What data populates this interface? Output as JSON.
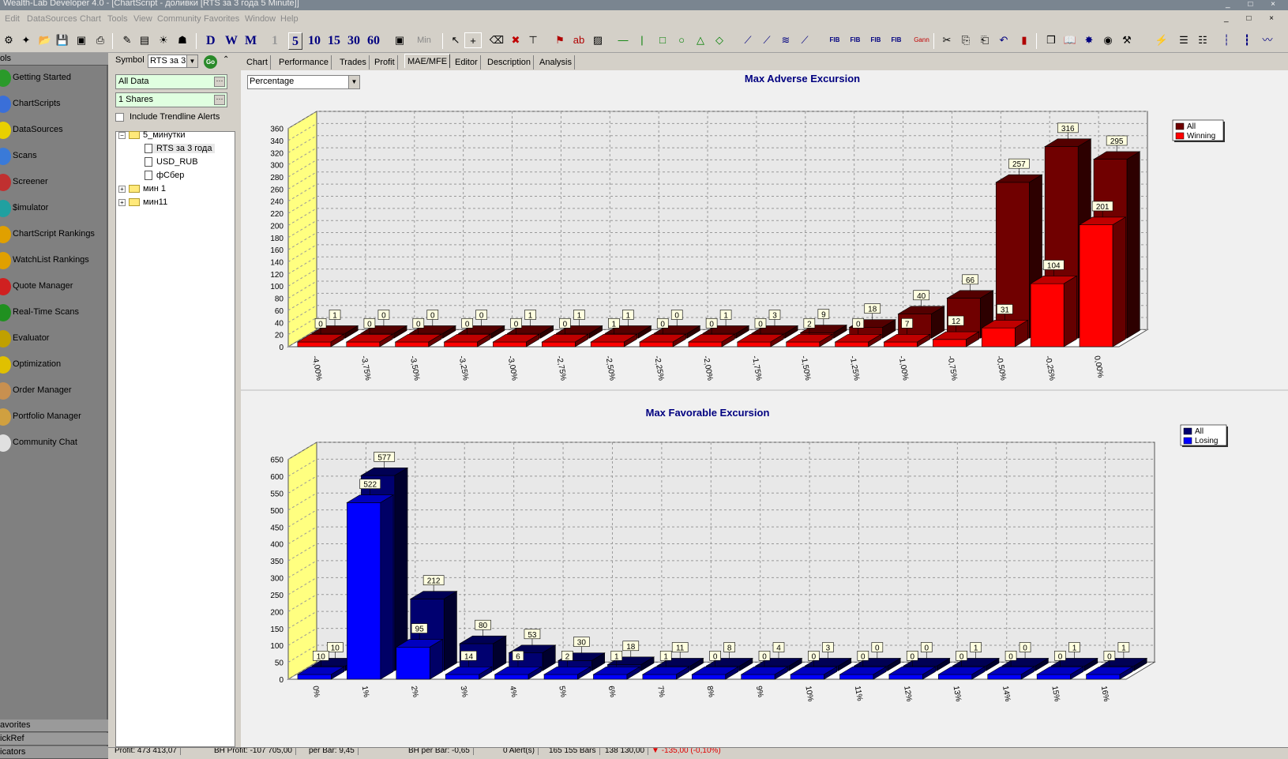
{
  "window": {
    "title": "Wealth-Lab Developer 4.0 - [ChartScript - доливки [RTS за 3 года 5 Minute]]"
  },
  "menu": [
    "Edit",
    "DataSources",
    "Chart",
    "Tools",
    "View",
    "Community",
    "Favorites",
    "Window",
    "Help"
  ],
  "toolbar": {
    "period_buttons": [
      "D",
      "W",
      "M",
      "1",
      "5",
      "10",
      "15",
      "30",
      "60"
    ],
    "min_label": "Min"
  },
  "left_panel": {
    "header": "ols",
    "items": [
      {
        "label": "Getting Started",
        "icon": "getting-started-icon",
        "color": "#2a9a2a"
      },
      {
        "label": "ChartScripts",
        "icon": "chartscripts-icon",
        "color": "#3a6fd8"
      },
      {
        "label": "DataSources",
        "icon": "datasources-icon",
        "color": "#e8d000"
      },
      {
        "label": "Scans",
        "icon": "scans-icon",
        "color": "#3a7ad8"
      },
      {
        "label": "Screener",
        "icon": "screener-icon",
        "color": "#c03030"
      },
      {
        "label": "$imulator",
        "icon": "simulator-icon",
        "color": "#20a0a0"
      },
      {
        "label": "ChartScript Rankings",
        "icon": "rankings-icon",
        "color": "#e0a000"
      },
      {
        "label": "WatchList Rankings",
        "icon": "watchlist-rankings-icon",
        "color": "#e0a000"
      },
      {
        "label": "Quote Manager",
        "icon": "quote-manager-icon",
        "color": "#d02020"
      },
      {
        "label": "Real-Time Scans",
        "icon": "realtime-scans-icon",
        "color": "#209020"
      },
      {
        "label": "Evaluator",
        "icon": "evaluator-icon",
        "color": "#c0a000"
      },
      {
        "label": "Optimization",
        "icon": "optimization-icon",
        "color": "#e0c000"
      },
      {
        "label": "Order Manager",
        "icon": "order-manager-icon",
        "color": "#c89050"
      },
      {
        "label": "Portfolio Manager",
        "icon": "portfolio-manager-icon",
        "color": "#d0a040"
      },
      {
        "label": "Community Chat",
        "icon": "community-chat-icon",
        "color": "#e0e0e0"
      }
    ],
    "bottom_sections": [
      "avorites",
      "ickRef",
      "icators"
    ]
  },
  "middle_panel": {
    "symbol_label": "Symbol",
    "symbol_value": "RTS за 3",
    "go_label": "Go",
    "data_range": "All Data",
    "position_size": "1 Shares",
    "trendline_label": "Include Trendline Alerts",
    "tree": [
      {
        "label": "5_минутки",
        "type": "folder",
        "expanded": true,
        "children": [
          "RTS за 3 года",
          "USD_RUB",
          "фСбер"
        ]
      },
      {
        "label": "мин 1",
        "type": "folder",
        "expanded": false
      },
      {
        "label": "мин11",
        "type": "folder",
        "expanded": false
      }
    ]
  },
  "tabs": [
    "Chart",
    "Performance",
    "Trades",
    "Profit",
    "MAE/MFE",
    "Editor",
    "Description",
    "Analysis"
  ],
  "active_tab": "MAE/MFE",
  "view_mode": "Percentage",
  "chart_data": [
    {
      "type": "bar",
      "title": "Max Adverse Excursion",
      "categories": [
        "-4,00%",
        "-3,75%",
        "-3,50%",
        "-3,25%",
        "-3,00%",
        "-2,75%",
        "-2,50%",
        "-2,25%",
        "-2,00%",
        "-1,75%",
        "-1,50%",
        "-1,25%",
        "-1,00%",
        "-0,75%",
        "-0,50%",
        "-0,25%",
        "0,00%"
      ],
      "series": [
        {
          "name": "All",
          "color": "#700000",
          "values": [
            1,
            0,
            0,
            0,
            1,
            1,
            1,
            0,
            1,
            3,
            9,
            18,
            40,
            66,
            257,
            316,
            295
          ]
        },
        {
          "name": "Winning",
          "color": "#ff0000",
          "values": [
            0,
            0,
            0,
            0,
            0,
            0,
            1,
            0,
            0,
            0,
            2,
            0,
            7,
            12,
            31,
            104,
            201
          ]
        }
      ],
      "yticks": [
        0,
        20,
        40,
        60,
        80,
        100,
        120,
        140,
        160,
        180,
        200,
        220,
        240,
        260,
        280,
        300,
        320,
        340,
        360
      ],
      "ylim": [
        0,
        360
      ],
      "grid": true,
      "legend": "top-right"
    },
    {
      "type": "bar",
      "title": "Max Favorable Excursion",
      "categories": [
        "0%",
        "1%",
        "2%",
        "3%",
        "4%",
        "5%",
        "6%",
        "7%",
        "8%",
        "9%",
        "10%",
        "11%",
        "12%",
        "13%",
        "14%",
        "15%",
        "16%"
      ],
      "series": [
        {
          "name": "All",
          "color": "#000070",
          "values": [
            10,
            577,
            212,
            80,
            53,
            30,
            18,
            11,
            8,
            4,
            3,
            0,
            0,
            1,
            0,
            1,
            1
          ]
        },
        {
          "name": "Losing",
          "color": "#0000ff",
          "values": [
            10,
            522,
            95,
            14,
            6,
            2,
            1,
            1,
            0,
            0,
            0,
            0,
            0,
            0,
            0,
            0,
            0
          ]
        }
      ],
      "yticks": [
        0,
        50,
        100,
        150,
        200,
        250,
        300,
        350,
        400,
        450,
        500,
        550,
        600,
        650
      ],
      "ylim": [
        0,
        650
      ],
      "grid": true,
      "legend": "top-right"
    }
  ],
  "status": {
    "profit": "Profit: 473 413,07",
    "bh_profit": "BH Profit: -107 705,00",
    "per_bar": "per Bar: 9,45",
    "bh_per_bar": "BH per Bar: -0,65",
    "alerts": "0 Alert(s)",
    "bars": "165 155 Bars",
    "price": "138 130,00",
    "change": "-135,00  (-0,10%)"
  }
}
